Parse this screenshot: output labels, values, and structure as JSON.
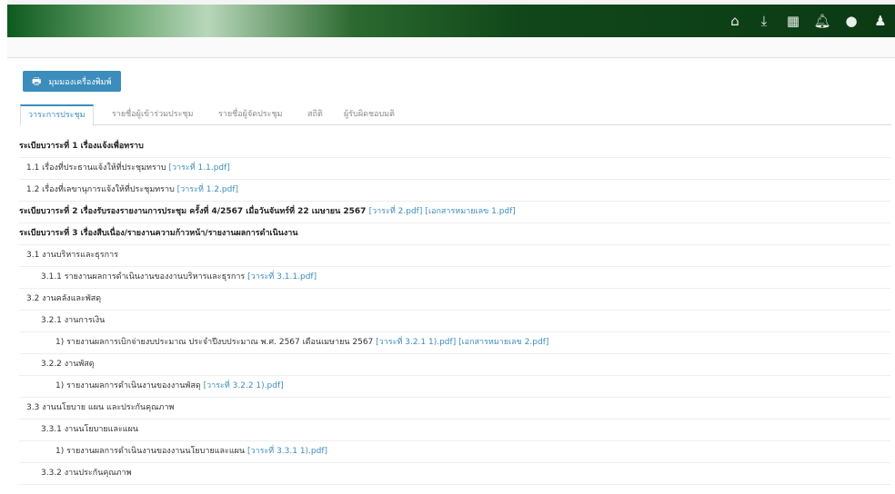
{
  "topbar": {
    "icons": [
      "home-icon",
      "download-icon",
      "calendar-icon",
      "bell-icon",
      "chat-icon",
      "user-icon"
    ],
    "glyphs": [
      "⌂",
      "⤓",
      "▦",
      "🔔︎",
      "●",
      "♟"
    ]
  },
  "print_button": {
    "icon": "print-icon",
    "label": "มุมมองเครื่องพิมพ์"
  },
  "tabs": [
    {
      "label": "วาระการประชุม",
      "active": true
    },
    {
      "label": "รายชื่อผู้เข้าร่วมประชุม"
    },
    {
      "label": "รายชื่อผู้จัดประชุม"
    },
    {
      "label": "สถิติ"
    },
    {
      "label": "ผู้รับผิดชอบมติ"
    }
  ],
  "agenda": [
    {
      "text": "ระเบียบวาระที่ 1 เรื่องแจ้งเพื่อทราบ"
    },
    {
      "text": "1.1 เรื่องที่ประธานแจ้งให้ที่ประชุมทราบ",
      "links": [
        "[วาระที่ 1.1.pdf]"
      ]
    },
    {
      "text": "1.2 เรื่องที่เลขานุการแจ้งให้ที่ประชุมทราบ",
      "links": [
        "[วาระที่ 1.2.pdf]"
      ]
    },
    {
      "text": "ระเบียบวาระที่ 2 เรื่องรับรองรายงานการประชุม ครั้งที่ 4/2567 เมื่อวันจันทร์ที่ 22 เมษายน 2567",
      "links": [
        "[วาระที่ 2.pdf]",
        "[เอกสารหมายเลข 1.pdf]"
      ]
    },
    {
      "text": "ระเบียบวาระที่ 3 เรื่องสืบเนื่อง/รายงานความก้าวหน้า/รายงานผลการดำเนินงาน"
    },
    {
      "text": "3.1 งานบริหารและธุรการ"
    },
    {
      "text": "3.1.1 รายงานผลการดำเนินงานของงานบริหารและธุรการ",
      "links": [
        "[วาระที่ 3.1.1.pdf]"
      ]
    },
    {
      "text": "3.2 งานคลังและพัสดุ"
    },
    {
      "text": "3.2.1 งานการเงิน"
    },
    {
      "text": "1) รายงานผลการเบิกจ่ายงบประมาณ ประจำปีงบประมาณ พ.ศ. 2567 เดือนเมษายน 2567",
      "links": [
        "[วาระที่ 3.2.1 1).pdf]",
        "[เอกสารหมายเลข 2.pdf]"
      ]
    },
    {
      "text": "3.2.2 งานพัสดุ"
    },
    {
      "text": "1) รายงานผลการดำเนินงานของงานพัสดุ",
      "links": [
        "[วาระที่ 3.2.2 1).pdf]"
      ]
    },
    {
      "text": "3.3 งานนโยบาย แผน และประกันคุณภาพ"
    },
    {
      "text": "3.3.1 งานนโยบายและแผน"
    },
    {
      "text": "1) รายงานผลการดำเนินงานของงานนโยบายและแผน",
      "links": [
        "[วาระที่ 3.3.1 1).pdf]"
      ]
    },
    {
      "text": "3.3.2 งานประกันคุณภาพ"
    }
  ]
}
